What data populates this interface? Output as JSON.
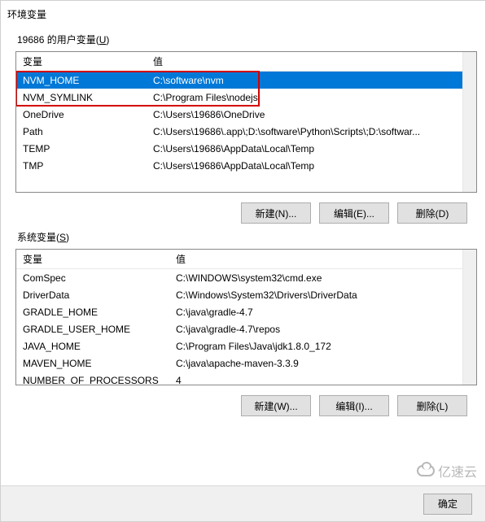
{
  "dialog_title": "环境变量",
  "user_vars": {
    "label_prefix": "19686 的用户变量(",
    "label_hotkey": "U",
    "label_suffix": ")",
    "col_name": "变量",
    "col_value": "值",
    "rows": [
      {
        "name": "NVM_HOME",
        "value": "C:\\software\\nvm",
        "selected": true,
        "boxed": true
      },
      {
        "name": "NVM_SYMLINK",
        "value": "C:\\Program Files\\nodejs",
        "selected": false,
        "boxed": true
      },
      {
        "name": "OneDrive",
        "value": "C:\\Users\\19686\\OneDrive",
        "selected": false
      },
      {
        "name": "Path",
        "value": "C:\\Users\\19686\\.app\\;D:\\software\\Python\\Scripts\\;D:\\softwar...",
        "selected": false
      },
      {
        "name": "TEMP",
        "value": "C:\\Users\\19686\\AppData\\Local\\Temp",
        "selected": false
      },
      {
        "name": "TMP",
        "value": "C:\\Users\\19686\\AppData\\Local\\Temp",
        "selected": false
      }
    ],
    "buttons": {
      "new": "新建(N)...",
      "edit": "编辑(E)...",
      "delete": "删除(D)"
    }
  },
  "sys_vars": {
    "label_prefix": "系统变量(",
    "label_hotkey": "S",
    "label_suffix": ")",
    "col_name": "变量",
    "col_value": "值",
    "rows": [
      {
        "name": "ComSpec",
        "value": "C:\\WINDOWS\\system32\\cmd.exe"
      },
      {
        "name": "DriverData",
        "value": "C:\\Windows\\System32\\Drivers\\DriverData"
      },
      {
        "name": "GRADLE_HOME",
        "value": "C:\\java\\gradle-4.7"
      },
      {
        "name": "GRADLE_USER_HOME",
        "value": "C:\\java\\gradle-4.7\\repos"
      },
      {
        "name": "JAVA_HOME",
        "value": "C:\\Program Files\\Java\\jdk1.8.0_172"
      },
      {
        "name": "MAVEN_HOME",
        "value": "C:\\java\\apache-maven-3.3.9"
      },
      {
        "name": "NUMBER_OF_PROCESSORS",
        "value": "4"
      }
    ],
    "buttons": {
      "new": "新建(W)...",
      "edit": "编辑(I)...",
      "delete": "删除(L)"
    }
  },
  "bottom": {
    "ok": "确定"
  },
  "watermark": "亿速云"
}
